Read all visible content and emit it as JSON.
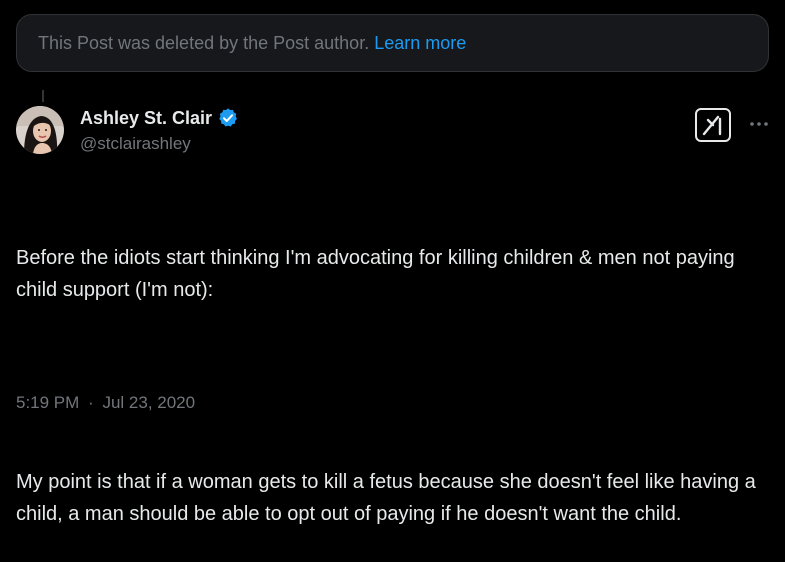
{
  "deleted_notice": {
    "text": "This Post was deleted by the Post author.",
    "link": "Learn more"
  },
  "author": {
    "name": "Ashley St. Clair",
    "handle": "@stclairashley",
    "verified": true
  },
  "tweet": {
    "paragraph1": "Before the idiots start thinking I'm advocating for killing children & men not paying child support (I'm not):",
    "paragraph2": "My point is that if a woman gets to kill a fetus because she doesn't feel like having a child, a man should be able to opt out of paying if he doesn't want the child."
  },
  "timestamp": {
    "time": "5:19 PM",
    "separator": "·",
    "date": "Jul 23, 2020"
  },
  "icons": {
    "grok": "grok-icon",
    "more": "more-options-icon",
    "verified": "verified-badge-icon"
  },
  "colors": {
    "background": "#000000",
    "text": "#e7e9ea",
    "secondary": "#71767b",
    "accent": "#1d9bf0",
    "banner_bg": "#16181c"
  }
}
